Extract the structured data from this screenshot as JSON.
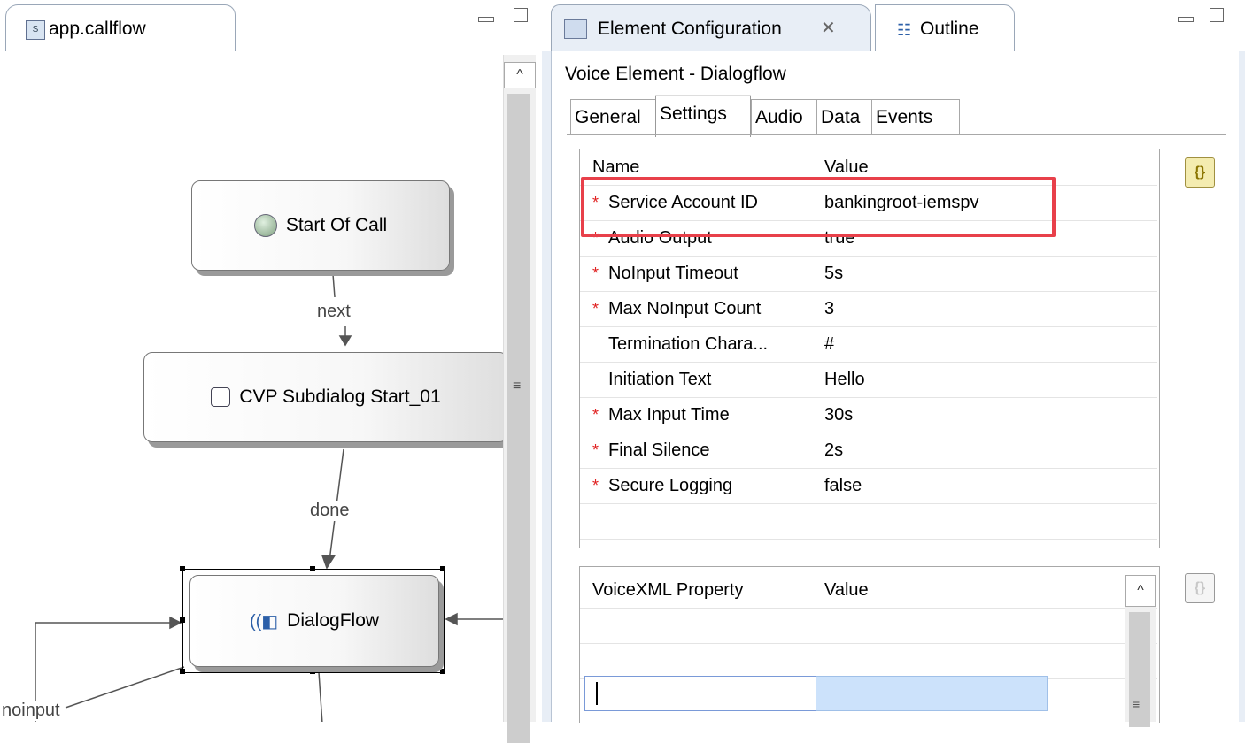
{
  "left_editor": {
    "tab_label": "app.callflow",
    "nodes": {
      "start": "Start Of Call",
      "subdialog": "CVP Subdialog Start_01",
      "dialogflow": "DialogFlow"
    },
    "connections": {
      "next": "next",
      "done": "done",
      "noinput": "noinput"
    }
  },
  "right_panel": {
    "tabs": {
      "config": "Element Configuration",
      "outline": "Outline"
    },
    "title": "Voice Element - Dialogflow",
    "subtabs": {
      "general": "General",
      "settings": "Settings",
      "audio": "Audio",
      "data": "Data",
      "events": "Events"
    },
    "settings_table": {
      "headers": {
        "name": "Name",
        "value": "Value"
      },
      "rows": [
        {
          "name": "Service Account ID",
          "value": "bankingroot-iemspv",
          "required": true
        },
        {
          "name": "Audio Output",
          "value": "true",
          "required": true
        },
        {
          "name": "NoInput Timeout",
          "value": "5s",
          "required": true
        },
        {
          "name": "Max NoInput Count",
          "value": "3",
          "required": true
        },
        {
          "name": "Termination Chara...",
          "value": "#",
          "required": false
        },
        {
          "name": "Initiation Text",
          "value": "Hello",
          "required": false
        },
        {
          "name": "Max Input Time",
          "value": "30s",
          "required": true
        },
        {
          "name": "Final Silence",
          "value": "2s",
          "required": true
        },
        {
          "name": "Secure Logging",
          "value": "false",
          "required": true
        }
      ],
      "required_marker": "*"
    },
    "vxml_table": {
      "headers": {
        "name": "VoiceXML Property",
        "value": "Value"
      }
    },
    "brace_icon": "{}",
    "colors": {
      "highlight": "#e8404a",
      "required": "#e02020",
      "selected_cell": "#cce2fb"
    }
  }
}
